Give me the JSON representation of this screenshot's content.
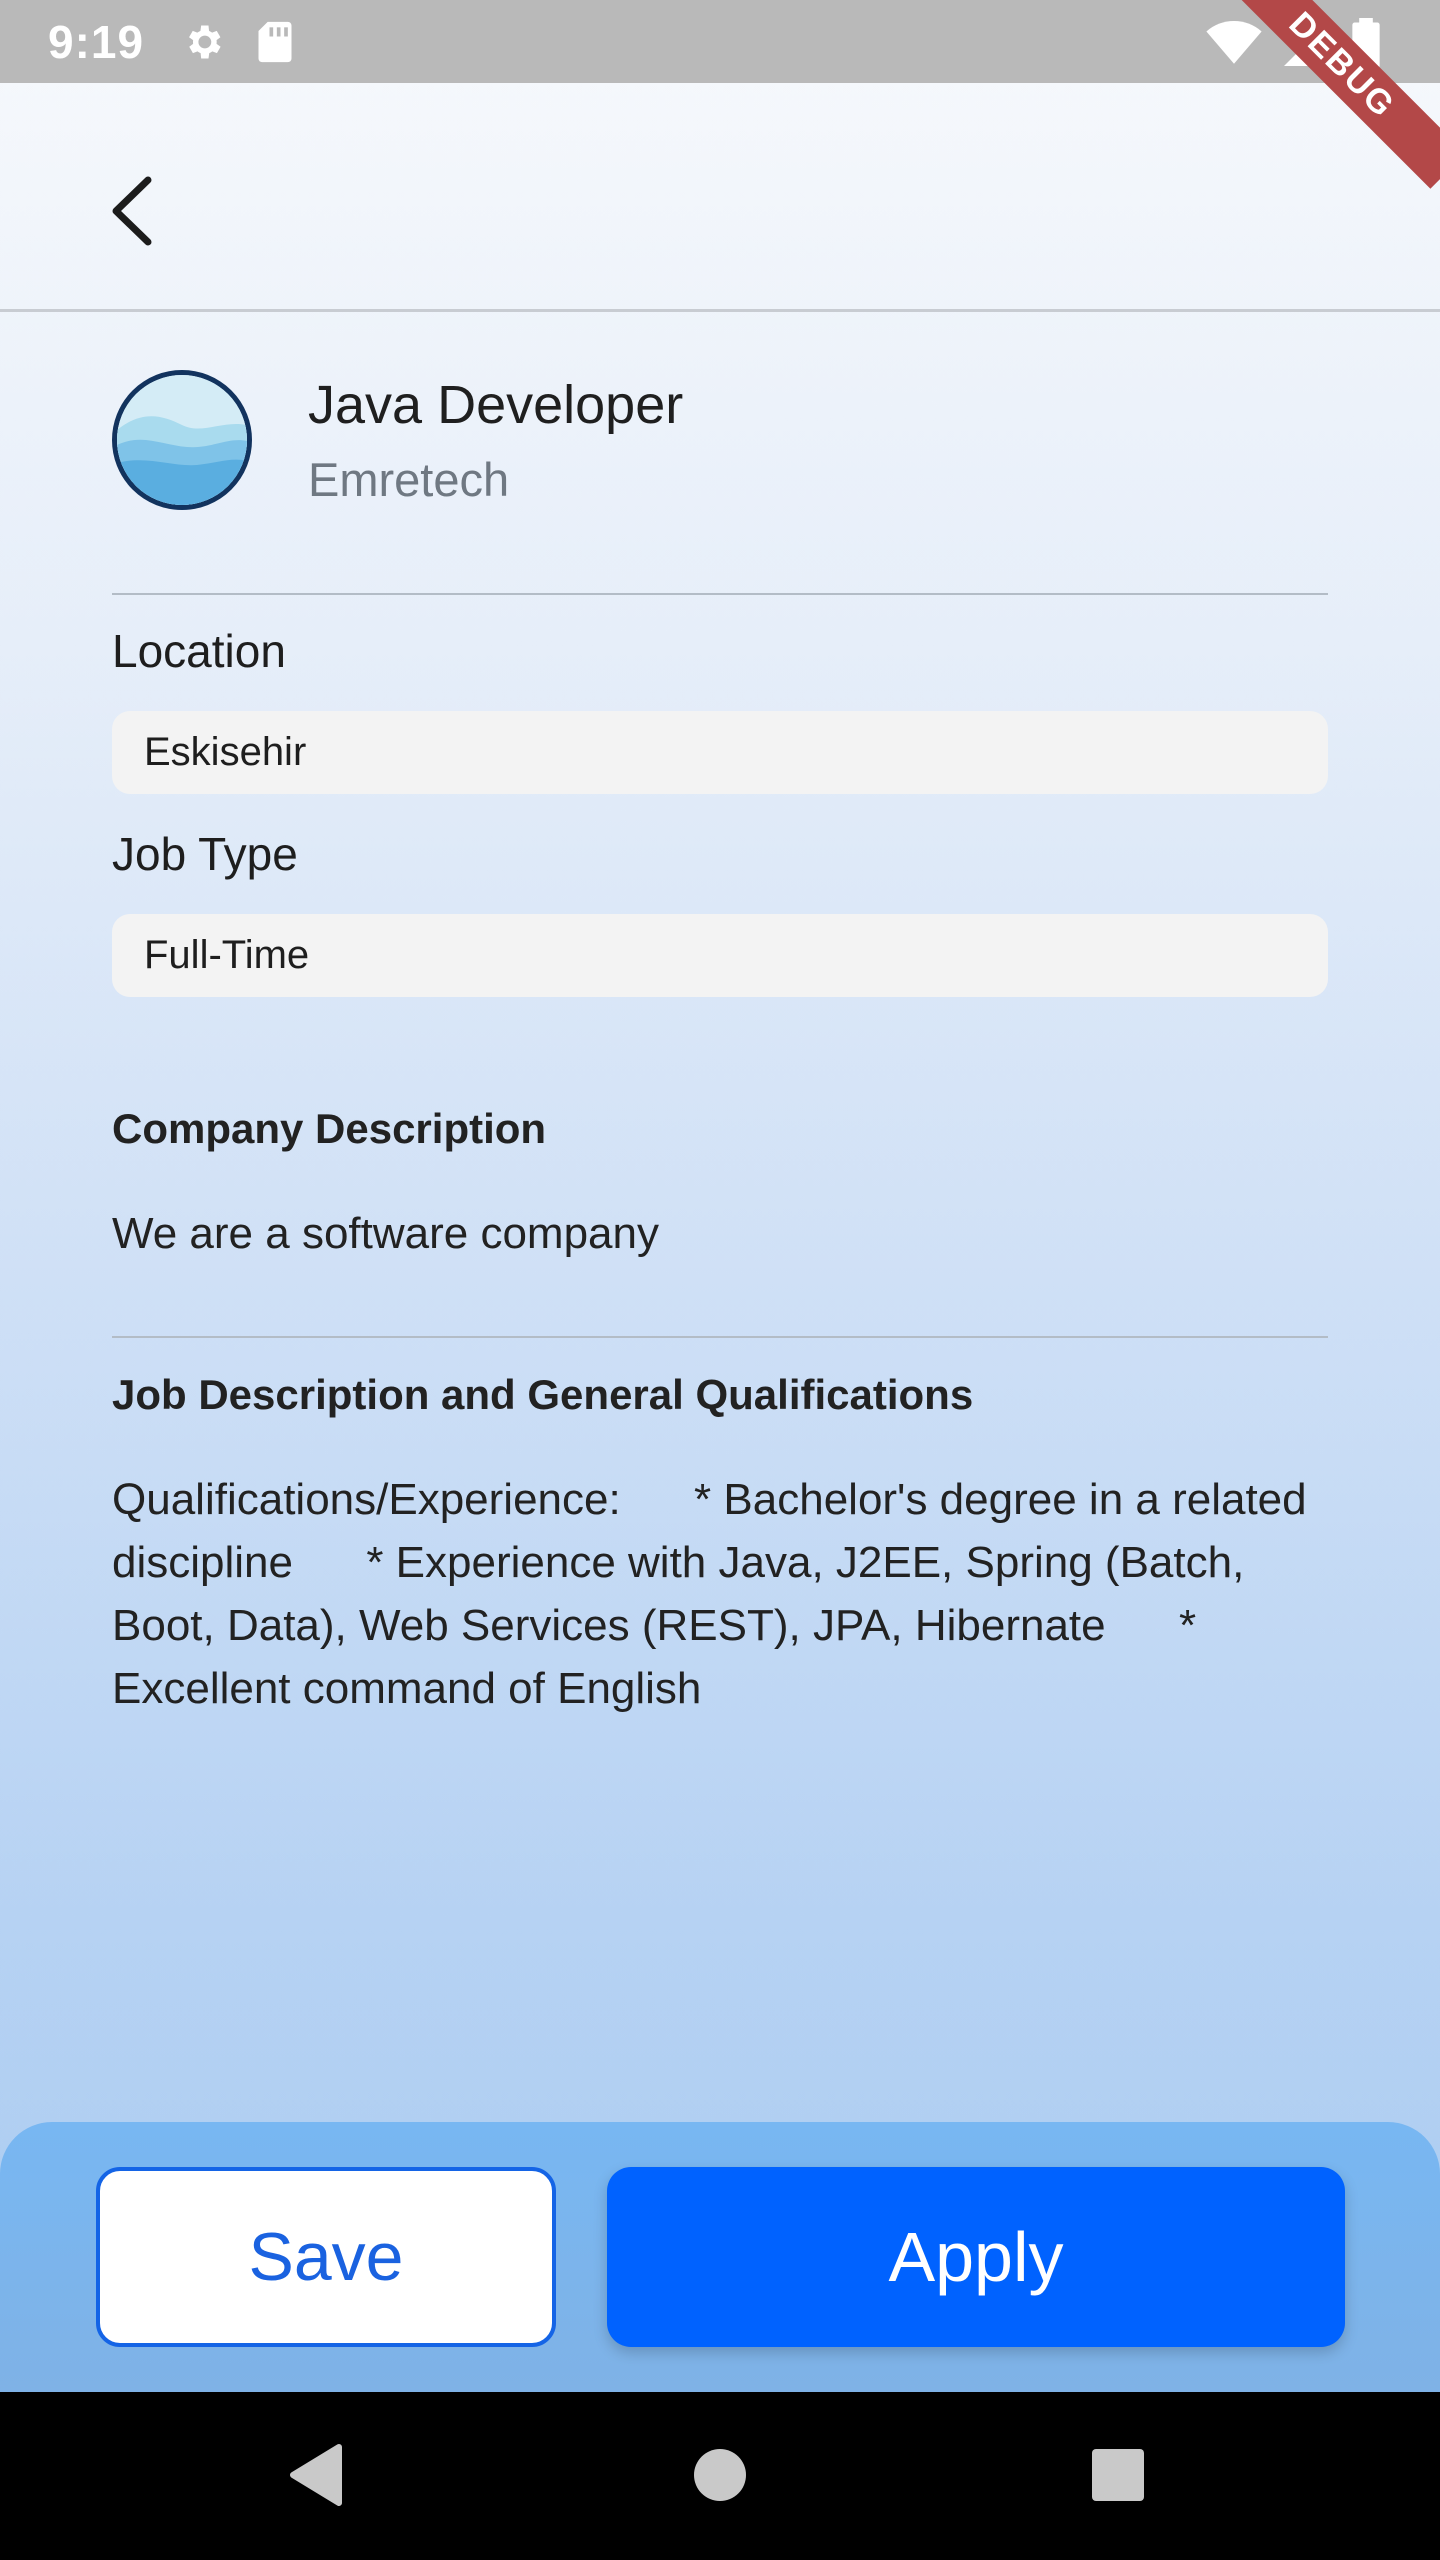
{
  "status_bar": {
    "time": "9:19",
    "icons": [
      "gear-icon",
      "sd-card-icon",
      "wifi-icon",
      "signal-icon",
      "battery-icon"
    ]
  },
  "debug_banner": "DEBUG",
  "app_bar": {
    "back_icon": "chevron-left-icon"
  },
  "job": {
    "title": "Java Developer",
    "company": "Emretech",
    "logo_icon": "wave-logo-icon"
  },
  "fields": {
    "location_label": "Location",
    "location_value": "Eskisehir",
    "job_type_label": "Job Type",
    "job_type_value": "Full-Time"
  },
  "company_description": {
    "title": "Company Description",
    "text": "We are a software company"
  },
  "job_description": {
    "title": "Job Description and General Qualifications",
    "text": "Qualifications/Experience:      * Bachelor's degree in a related discipline      * Experience with Java, J2EE, Spring (Batch, Boot, Data), Web Services (REST), JPA, Hibernate      * Excellent command of English"
  },
  "actions": {
    "save_label": "Save",
    "apply_label": "Apply"
  },
  "colors": {
    "accent": "#0062ff",
    "save_text": "#1a62e0",
    "status_bar": "#b9b9b9",
    "debug_banner": "#b34848"
  },
  "nav_bar": {
    "icons": [
      "back-triangle-icon",
      "home-circle-icon",
      "recents-square-icon"
    ]
  }
}
